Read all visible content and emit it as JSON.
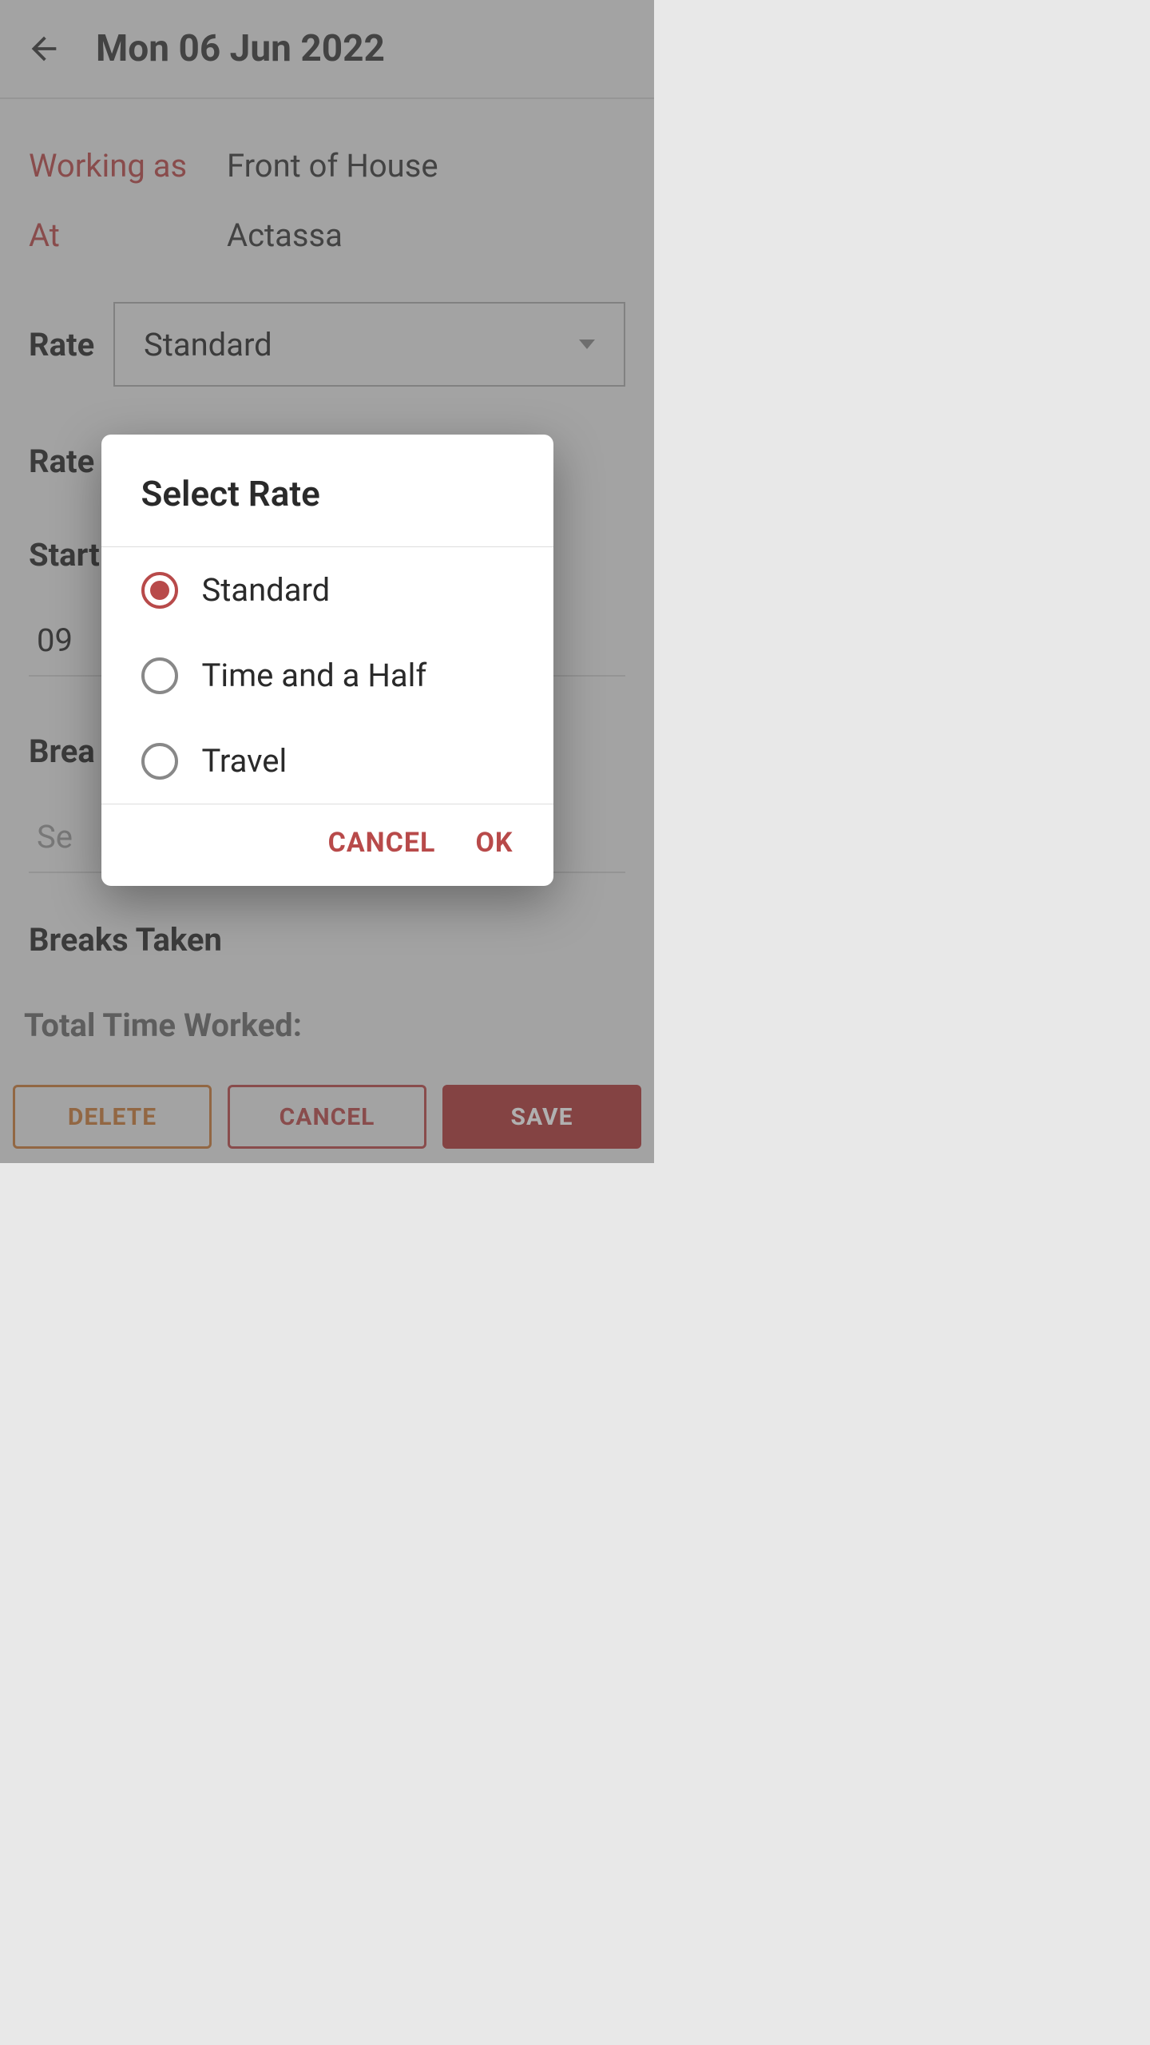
{
  "header": {
    "title": "Mon 06 Jun 2022"
  },
  "info": {
    "working_as_label": "Working as",
    "working_as_value": "Front of House",
    "at_label": "At",
    "at_value": "Actassa"
  },
  "rate": {
    "label": "Rate",
    "selected": "Standard",
    "second_label": "Rate"
  },
  "start": {
    "label": "Start",
    "time": "09"
  },
  "breaks": {
    "label": "Brea",
    "placeholder": "Se",
    "taken_label": "Breaks Taken"
  },
  "footer": {
    "total_label": "Total Time Worked:",
    "delete": "DELETE",
    "cancel": "CANCEL",
    "save": "SAVE"
  },
  "dialog": {
    "title": "Select Rate",
    "options": [
      {
        "label": "Standard",
        "selected": true
      },
      {
        "label": "Time and a Half",
        "selected": false
      },
      {
        "label": "Travel",
        "selected": false
      }
    ],
    "cancel": "CANCEL",
    "ok": "OK"
  }
}
